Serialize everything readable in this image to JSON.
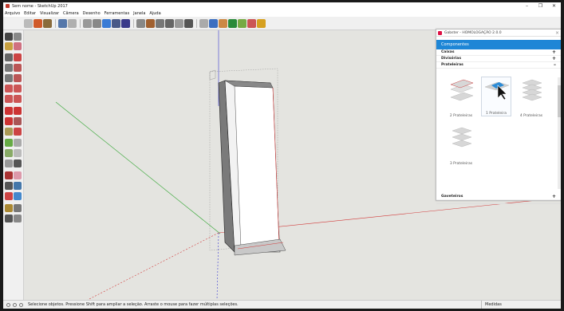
{
  "window": {
    "title": "Sem nome - SketchUp 2017",
    "controls": [
      "–",
      "❐",
      "✕"
    ]
  },
  "menu": [
    "Arquivo",
    "Editar",
    "Visualizar",
    "Câmera",
    "Desenho",
    "Ferramentas",
    "Janela",
    "Ajuda"
  ],
  "tray": {
    "title": "Gabster - HOMOLOGAÇÃO 2.0.0",
    "header": "Componentes",
    "sections": [
      {
        "label": "Caixas",
        "toggle": "+"
      },
      {
        "label": "Divisórias",
        "toggle": "+"
      },
      {
        "label": "Prateleiras",
        "toggle": "–"
      }
    ],
    "items": [
      {
        "label": "",
        "icon": "shelf-plain-icon"
      },
      {
        "label": "1 Prateleira",
        "icon": "shelf-hover-icon"
      },
      {
        "label": "",
        "icon": "shelf-stack-icon"
      },
      {
        "label": "2 Prateleiras",
        "icon": "shelf-two-icon"
      },
      {
        "label": "",
        "icon": "shelf-one-icon"
      },
      {
        "label": "4 Prateleiras",
        "icon": "shelf-four-icon"
      },
      {
        "label": "3 Prateleiras",
        "icon": "shelf-three-icon"
      }
    ],
    "footer": {
      "label": "Gaveteiros",
      "toggle": "+"
    }
  },
  "status": {
    "message": "Selecione objetos. Pressione Shift para ampliar a seleção. Arraste o mouse para fazer múltiplas seleções.",
    "measures_label": "Medidas"
  },
  "colors": {
    "accent": "#1e86d6",
    "axis_red": "#d23b3b",
    "axis_green": "#2fa52f",
    "axis_blue": "#3b3bd2",
    "sky": "#e4e4e0"
  }
}
